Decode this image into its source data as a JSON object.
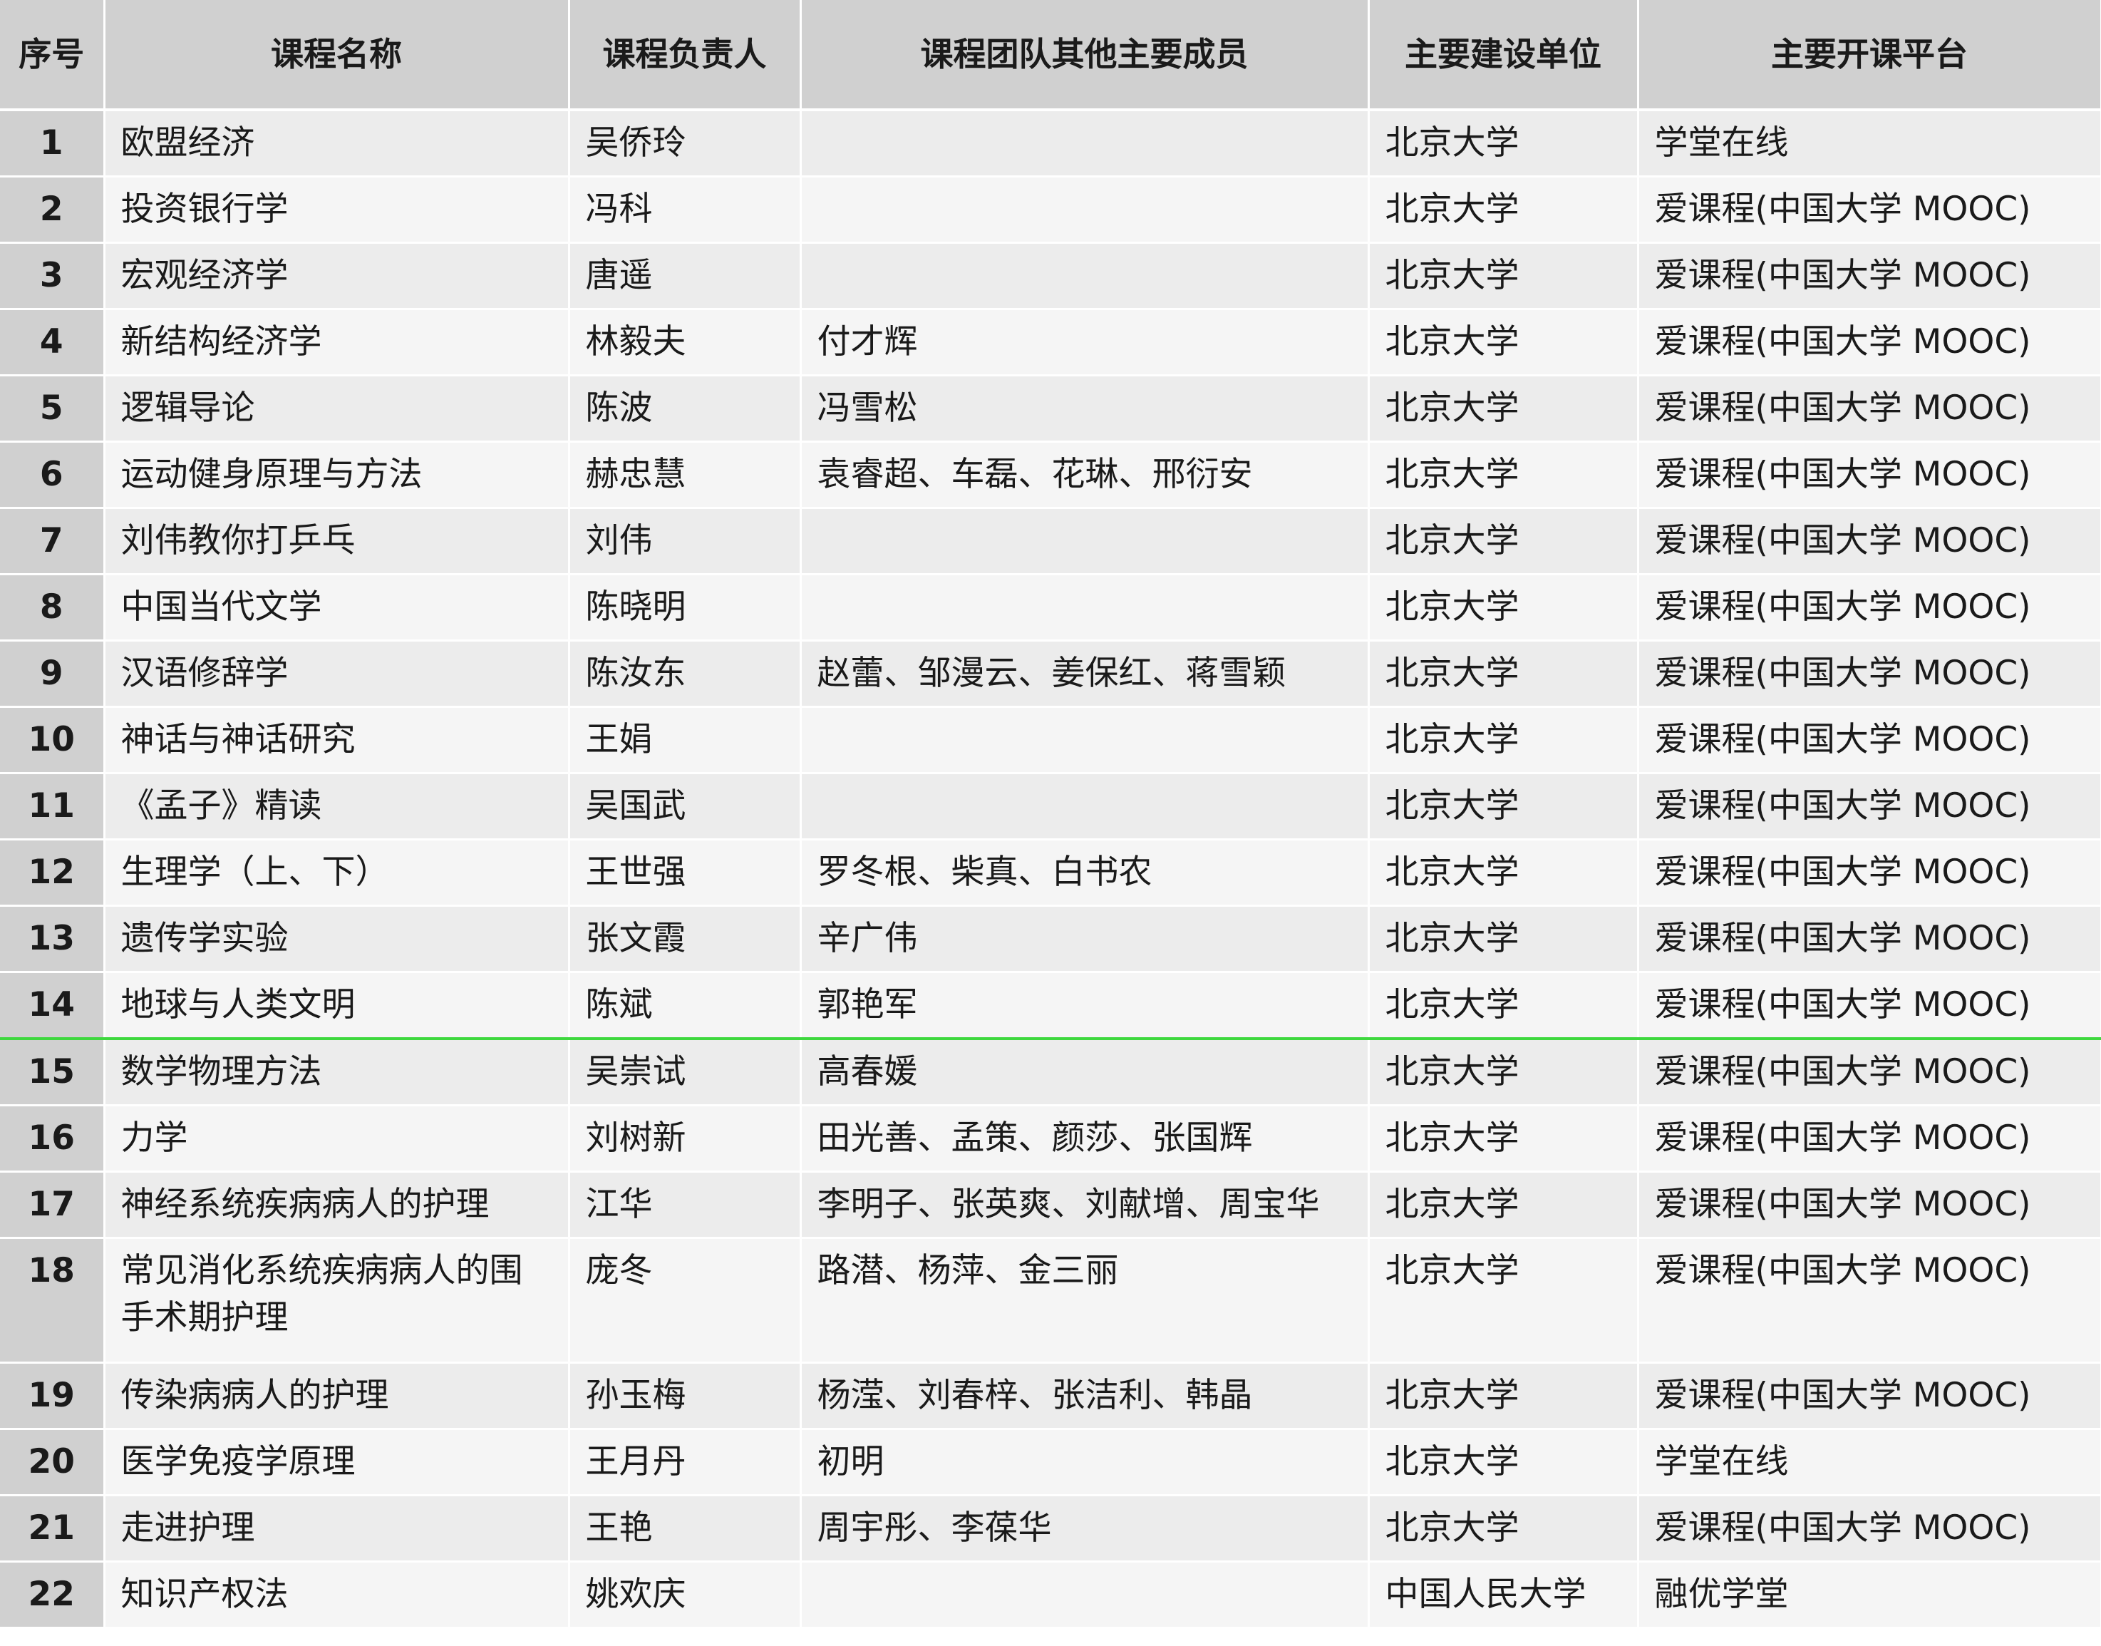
{
  "headers": {
    "index": "序号",
    "course_name": "课程名称",
    "lead": "课程负责人",
    "team": "课程团队其他主要成员",
    "unit": "主要建设单位",
    "platform": "主要开课平台"
  },
  "rows": [
    {
      "no": "1",
      "name": "欧盟经济",
      "lead": "吴侨玲",
      "team": "",
      "unit": "北京大学",
      "platform": "学堂在线"
    },
    {
      "no": "2",
      "name": "投资银行学",
      "lead": "冯科",
      "team": "",
      "unit": "北京大学",
      "platform": "爱课程(中国大学  MOOC)"
    },
    {
      "no": "3",
      "name": "宏观经济学",
      "lead": "唐遥",
      "team": "",
      "unit": "北京大学",
      "platform": "爱课程(中国大学  MOOC)"
    },
    {
      "no": "4",
      "name": "新结构经济学",
      "lead": "林毅夫",
      "team": "付才辉",
      "unit": "北京大学",
      "platform": "爱课程(中国大学  MOOC)"
    },
    {
      "no": "5",
      "name": "逻辑导论",
      "lead": "陈波",
      "team": "冯雪松",
      "unit": "北京大学",
      "platform": "爱课程(中国大学  MOOC)"
    },
    {
      "no": "6",
      "name": "运动健身原理与方法",
      "lead": "赫忠慧",
      "team": "袁睿超、车磊、花琳、邢衍安",
      "unit": "北京大学",
      "platform": "爱课程(中国大学  MOOC)"
    },
    {
      "no": "7",
      "name": "刘伟教你打乒乓",
      "lead": "刘伟",
      "team": "",
      "unit": "北京大学",
      "platform": "爱课程(中国大学  MOOC)"
    },
    {
      "no": "8",
      "name": "中国当代文学",
      "lead": "陈晓明",
      "team": "",
      "unit": "北京大学",
      "platform": "爱课程(中国大学  MOOC)"
    },
    {
      "no": "9",
      "name": "汉语修辞学",
      "lead": "陈汝东",
      "team": "赵蕾、邹漫云、姜保红、蒋雪颖",
      "unit": "北京大学",
      "platform": "爱课程(中国大学  MOOC)"
    },
    {
      "no": "10",
      "name": "神话与神话研究",
      "lead": "王娟",
      "team": "",
      "unit": "北京大学",
      "platform": "爱课程(中国大学  MOOC)"
    },
    {
      "no": "11",
      "name": "《孟子》精读",
      "lead": "吴国武",
      "team": "",
      "unit": "北京大学",
      "platform": "爱课程(中国大学  MOOC)"
    },
    {
      "no": "12",
      "name": "生理学（上、下）",
      "lead": "王世强",
      "team": "罗冬根、柴真、白书农",
      "unit": "北京大学",
      "platform": "爱课程(中国大学  MOOC)"
    },
    {
      "no": "13",
      "name": "遗传学实验",
      "lead": "张文霞",
      "team": "辛广伟",
      "unit": "北京大学",
      "platform": "爱课程(中国大学  MOOC)"
    },
    {
      "no": "14",
      "name": "地球与人类文明",
      "lead": "陈斌",
      "team": "郭艳军",
      "unit": "北京大学",
      "platform": "爱课程(中国大学  MOOC)"
    },
    {
      "no": "15",
      "name": "数学物理方法",
      "lead": "吴崇试",
      "team": "高春媛",
      "unit": "北京大学",
      "platform": "爱课程(中国大学  MOOC)"
    },
    {
      "no": "16",
      "name": "力学",
      "lead": "刘树新",
      "team": "田光善、孟策、颜莎、张国辉",
      "unit": "北京大学",
      "platform": "爱课程(中国大学  MOOC)"
    },
    {
      "no": "17",
      "name": "神经系统疾病病人的护理",
      "lead": "江华",
      "team": "李明子、张英爽、刘献增、周宝华",
      "unit": "北京大学",
      "platform": "爱课程(中国大学  MOOC)"
    },
    {
      "no": "18",
      "name": "常见消化系统疾病病人的围手术期护理",
      "lead": "庞冬",
      "team": "路潜、杨萍、金三丽",
      "unit": "北京大学",
      "platform": "爱课程(中国大学  MOOC)"
    },
    {
      "no": "19",
      "name": "传染病病人的护理",
      "lead": "孙玉梅",
      "team": "杨滢、刘春梓、张洁利、韩晶",
      "unit": "北京大学",
      "platform": "爱课程(中国大学  MOOC)"
    },
    {
      "no": "20",
      "name": "医学免疫学原理",
      "lead": "王月丹",
      "team": "初明",
      "unit": "北京大学",
      "platform": "学堂在线"
    },
    {
      "no": "21",
      "name": "走进护理",
      "lead": "王艳",
      "team": "周宇彤、李葆华",
      "unit": "北京大学",
      "platform": "爱课程(中国大学  MOOC)"
    },
    {
      "no": "22",
      "name": "知识产权法",
      "lead": "姚欢庆",
      "team": "",
      "unit": "中国人民大学",
      "platform": "融优学堂"
    }
  ]
}
